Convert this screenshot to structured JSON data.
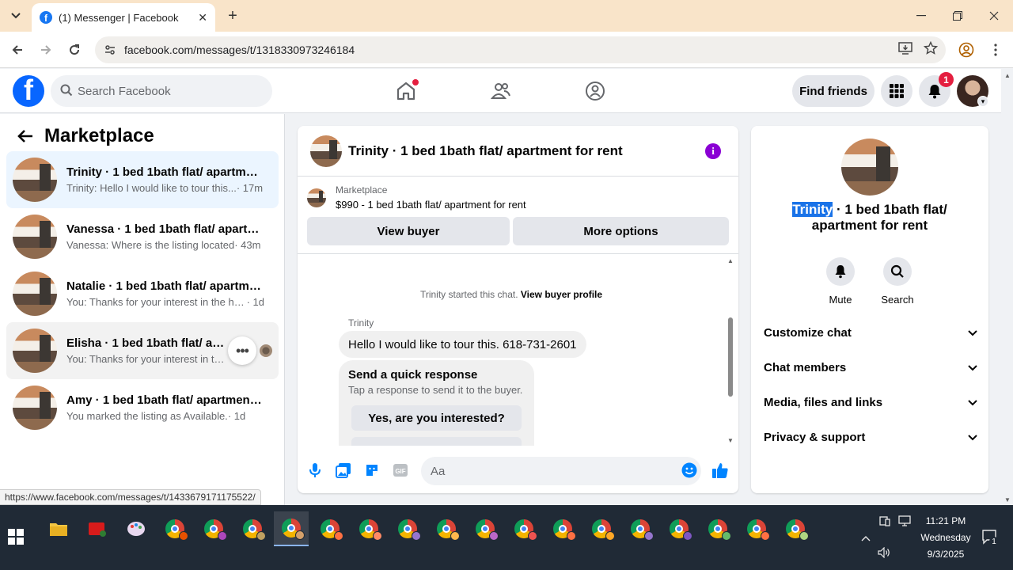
{
  "browser": {
    "tab_title": "(1) Messenger | Facebook",
    "url": "facebook.com/messages/t/1318330973246184",
    "status_url": "https://www.facebook.com/messages/t/1433679171175522/"
  },
  "fbnav": {
    "search_placeholder": "Search Facebook",
    "find_friends": "Find friends",
    "notification_count": "1"
  },
  "sidebar": {
    "title": "Marketplace",
    "conversations": [
      {
        "name": "Trinity · 1 bed 1bath flat/ apartmen...",
        "message": "Trinity: Hello I would like to tour this...",
        "time": " · 17m"
      },
      {
        "name": "Vanessa · 1 bed 1bath flat/ apartm...",
        "message": "Vanessa: Where is the listing located",
        "time": " · 43m"
      },
      {
        "name": "Natalie · 1 bed 1bath flat/ apartme...",
        "message": "You: Thanks for your interest in the ho...",
        "time": " · 1d"
      },
      {
        "name": "Elisha · 1 bed 1bath flat/ apartm",
        "message": "You: Thanks for your interest in the...",
        "time": ""
      },
      {
        "name": "Amy · 1 bed 1bath flat/ apartment ...",
        "message": "You marked the listing as Available.",
        "time": " · 1d"
      }
    ]
  },
  "chat": {
    "title": "Trinity · 1 bed 1bath flat/ apartment for rent",
    "marketplace_label": "Marketplace",
    "listing": "$990 - 1 bed 1bath flat/ apartment for rent",
    "view_buyer": "View buyer",
    "more_options": "More options",
    "started_text": "Trinity started this chat.",
    "view_buyer_profile": "View buyer profile",
    "sender": "Trinity",
    "message": "Hello I would like to tour this. 618-731-2601",
    "quick_title": "Send a quick response",
    "quick_sub": "Tap a response to send it to the buyer.",
    "quick_option": "Yes, are you interested?",
    "composer_placeholder": "Aa"
  },
  "details": {
    "title_highlight": "Trinity",
    "title_rest": " · 1 bed 1bath flat/ apartment for rent",
    "mute": "Mute",
    "search": "Search",
    "sections": [
      "Customize chat",
      "Chat members",
      "Media, files and links",
      "Privacy & support"
    ]
  },
  "taskbar": {
    "time": "11:21 PM",
    "day": "Wednesday",
    "date": "9/3/2025",
    "notif_count": "1"
  },
  "colors": {
    "fb_blue": "#0866ff",
    "messenger_blue": "#0084ff",
    "badge_red": "#e41e3f",
    "info_purple": "#8a00d4"
  }
}
